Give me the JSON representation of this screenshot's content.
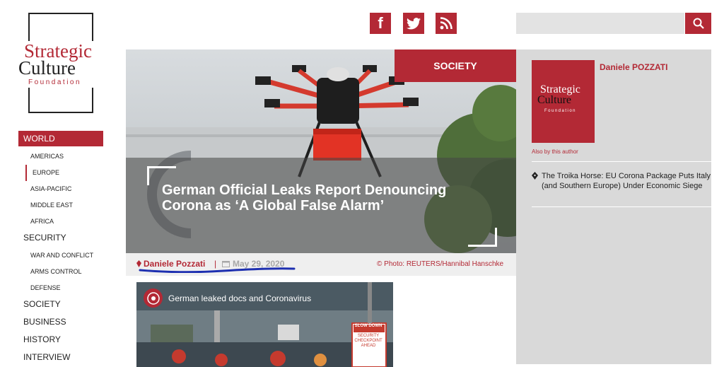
{
  "logo": {
    "line1": "Strategic",
    "line2": "Culture",
    "line3": "Foundation"
  },
  "nav": {
    "world": "WORLD",
    "world_items": [
      "AMERICAS",
      "EUROPE",
      "ASIA-PACIFIC",
      "MIDDLE EAST",
      "AFRICA"
    ],
    "security": "SECURITY",
    "security_items": [
      "WAR AND CONFLICT",
      "ARMS CONTROL",
      "DEFENSE"
    ],
    "society": "SOCIETY",
    "business": "BUSINESS",
    "history": "HISTORY",
    "interview": "INTERVIEW"
  },
  "social": {
    "facebook": "f",
    "twitter": "twitter-icon",
    "rss": "rss-icon"
  },
  "search": {
    "placeholder": ""
  },
  "hero": {
    "category": "SOCIETY",
    "title": "German Official Leaks Report Denouncing Corona as ‘A Global False Alarm’"
  },
  "meta": {
    "author": "Daniele Pozzati",
    "separator": "|",
    "date": "May 29, 2020",
    "photo_credit": "© Photo: REUTERS/Hannibal Hanschke"
  },
  "video": {
    "title": "German leaked docs and Coronavirus",
    "sign_line1": "SLOW DOWN",
    "sign_line2": "SECURITY",
    "sign_line3": "CHECKPOINT",
    "sign_line4": "AHEAD"
  },
  "sidebar": {
    "author_name": "Daniele POZZATI",
    "also_by": "Also by this author",
    "related": "The Troika Horse: EU Corona Package Puts Italy (and Southern Europe) Under Economic Siege"
  },
  "colors": {
    "brand": "#b32935",
    "sidebar_bg": "#d9d9d9"
  }
}
